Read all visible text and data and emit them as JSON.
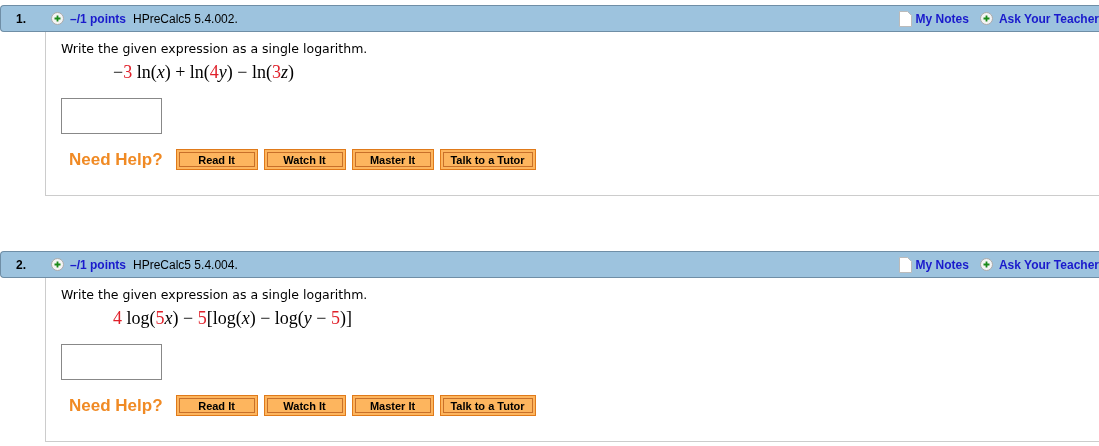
{
  "questions": [
    {
      "number": "1.",
      "points": "–/1 points",
      "source": "HPreCalc5 5.4.002.",
      "notes": "My Notes",
      "ask": "Ask Your Teacher",
      "prompt": "Write the given expression as a single logarithm.",
      "expression": [
        {
          "kind": "op",
          "text": "−"
        },
        {
          "kind": "num",
          "text": "3"
        },
        {
          "kind": "op",
          "text": " ln("
        },
        {
          "kind": "var",
          "text": "x"
        },
        {
          "kind": "op",
          "text": ") + ln("
        },
        {
          "kind": "num",
          "text": "4"
        },
        {
          "kind": "var",
          "text": "y"
        },
        {
          "kind": "op",
          "text": ") − ln("
        },
        {
          "kind": "num",
          "text": "3"
        },
        {
          "kind": "var",
          "text": "z"
        },
        {
          "kind": "op",
          "text": ")"
        }
      ],
      "help_label": "Need Help?",
      "help_buttons": [
        "Read It",
        "Watch It",
        "Master It",
        "Talk to a Tutor"
      ]
    },
    {
      "number": "2.",
      "points": "–/1 points",
      "source": "HPreCalc5 5.4.004.",
      "notes": "My Notes",
      "ask": "Ask Your Teacher",
      "prompt": "Write the given expression as a single logarithm.",
      "expression": [
        {
          "kind": "num",
          "text": "4"
        },
        {
          "kind": "op",
          "text": " log("
        },
        {
          "kind": "num",
          "text": "5"
        },
        {
          "kind": "var",
          "text": "x"
        },
        {
          "kind": "op",
          "text": ") − "
        },
        {
          "kind": "num",
          "text": "5"
        },
        {
          "kind": "op",
          "text": "[log("
        },
        {
          "kind": "var",
          "text": "x"
        },
        {
          "kind": "op",
          "text": ") − log("
        },
        {
          "kind": "var",
          "text": "y"
        },
        {
          "kind": "op",
          "text": " − "
        },
        {
          "kind": "num",
          "text": "5"
        },
        {
          "kind": "op",
          "text": ")]"
        }
      ],
      "help_label": "Need Help?",
      "help_buttons": [
        "Read It",
        "Watch It",
        "Master It",
        "Talk to a Tutor"
      ]
    }
  ]
}
